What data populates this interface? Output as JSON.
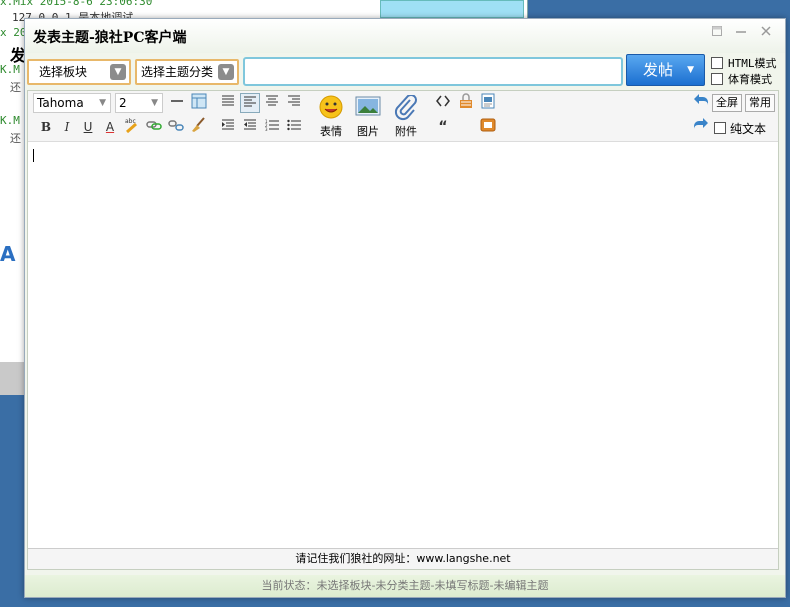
{
  "background_window": {
    "lines": [
      {
        "text": "x.Mix 2015-8-6 23:06:30",
        "color": "#2d8a2d"
      },
      {
        "text": "127.0.0.1 是本地调试",
        "color": "#333333"
      },
      {
        "text": "x 20",
        "color": "#2d8a2d"
      },
      {
        "text": "发",
        "color": "#000000"
      },
      {
        "text": "K.M",
        "color": "#2d8a2d"
      },
      {
        "text": "还",
        "color": "#555555"
      },
      {
        "text": "K.M",
        "color": "#2d8a2d"
      },
      {
        "text": "还",
        "color": "#555555"
      }
    ],
    "big_letter": "A"
  },
  "dialog": {
    "title": "发表主题-狼社PC客户端",
    "board_select": "选择板块",
    "category_select": "选择主题分类",
    "subject_value": "",
    "post_label": "发帖",
    "html_mode_label": "HTML模式",
    "sports_mode_label": "体育模式",
    "plain_text_label": "纯文本",
    "fullscreen_label": "全屏",
    "common_label": "常用"
  },
  "toolbar": {
    "font_family": "Tahoma",
    "font_size": "2",
    "bold": "B",
    "italic": "I",
    "underline": "U",
    "font_color": "A",
    "quote_glyph": "“",
    "emoticon_label": "表情",
    "image_label": "图片",
    "attachment_label": "附件"
  },
  "footer": {
    "note": "请记住我们狼社的网址：www.langshe.net"
  },
  "status": {
    "text": "当前状态：未选择板块-未分类主题-未填写标题-未编辑主题"
  },
  "colors": {
    "accent_blue": "#1b6fd0",
    "select_border": "#e8b86a",
    "subject_border": "#7fc7dc",
    "status_bg": "#dceccf"
  }
}
